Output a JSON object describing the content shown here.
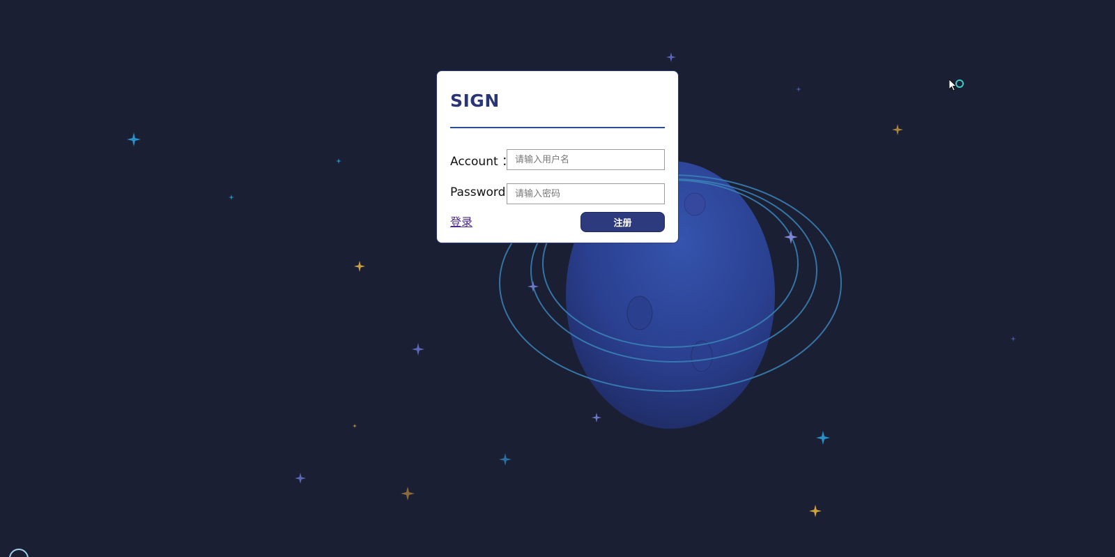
{
  "login_card": {
    "title": "SIGN",
    "account_label": "Account ：",
    "account_placeholder": "请输入用户名",
    "password_label": "Password:",
    "password_placeholder": "请输入密码",
    "login_link": "登录",
    "register_button": "注册"
  },
  "colors": {
    "background": "#1a1f33",
    "accent": "#2d3b7e",
    "title": "#2a3576",
    "planet": "#2e47a3",
    "ring": "#3a83b8"
  },
  "decor": {
    "planet": "planet-illustration",
    "stars": "sparkle-star-icons"
  }
}
